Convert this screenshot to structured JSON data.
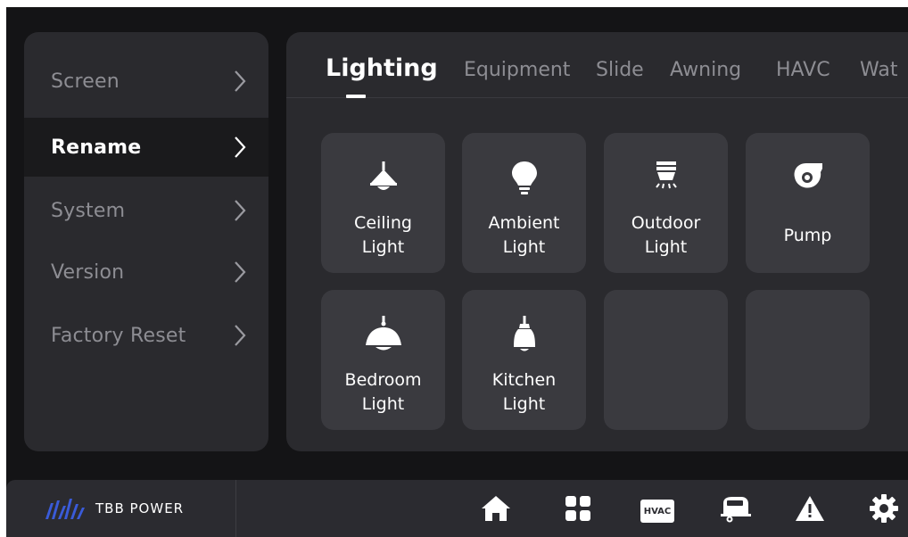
{
  "menu": {
    "items": [
      {
        "label": "Screen"
      },
      {
        "label": "Rename"
      },
      {
        "label": "System"
      },
      {
        "label": "Version"
      },
      {
        "label": "Factory Reset"
      }
    ],
    "active_index": 1
  },
  "tabs": [
    {
      "label": "Lighting"
    },
    {
      "label": "Equipment"
    },
    {
      "label": "Slide"
    },
    {
      "label": "Awning"
    },
    {
      "label": "HAVC"
    },
    {
      "label": "Wat"
    }
  ],
  "active_tab": "Lighting",
  "tiles": [
    {
      "line1": "Ceiling",
      "line2": "Light",
      "icon": "ceiling-lamp-icon"
    },
    {
      "line1": "Ambient",
      "line2": "Light",
      "icon": "bulb-icon"
    },
    {
      "line1": "Outdoor",
      "line2": "Light",
      "icon": "outdoor-light-icon"
    },
    {
      "line1": "Pump",
      "line2": "",
      "icon": "pump-icon"
    },
    {
      "line1": "Bedroom",
      "line2": "Light",
      "icon": "dome-lamp-icon"
    },
    {
      "line1": "Kitchen",
      "line2": "Light",
      "icon": "pendant-lamp-icon"
    }
  ],
  "brand": {
    "name": "TBB POWER"
  },
  "nav": {
    "home_icon": "home-icon",
    "grid_icon": "grid-icon",
    "hvac_label": "HVAC",
    "camper_icon": "camper-icon",
    "alert_icon": "warning-icon",
    "settings_icon": "gear-icon"
  },
  "colors": {
    "background": "#141416",
    "panel": "#2a2a2e",
    "tile": "#3a3a3f",
    "active_text": "#ffffff",
    "muted_text": "#8d8d93",
    "brand_blue": "#3a5bd9"
  }
}
